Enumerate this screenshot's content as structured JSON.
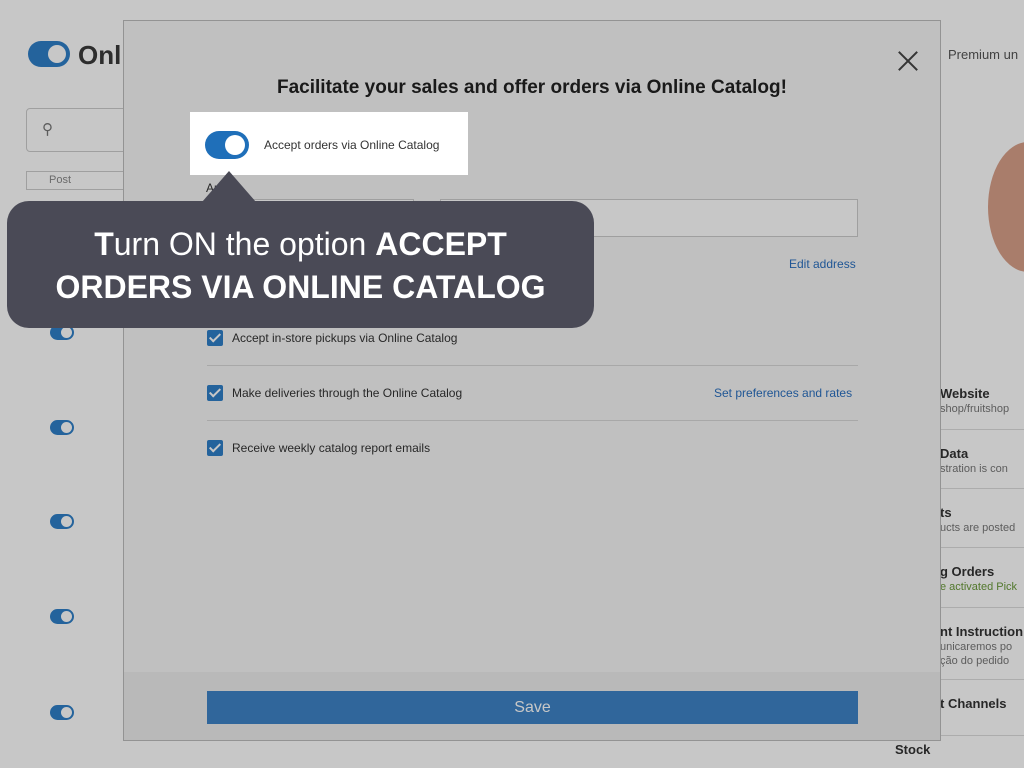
{
  "background": {
    "title": "Onli",
    "post_tab": "Post",
    "premium": "Premium un",
    "side_items": [
      {
        "title": "Website",
        "sub": "shop/fruitshop"
      },
      {
        "title": "Data",
        "sub": "stration is con"
      },
      {
        "title": "ts",
        "sub": "ucts are posted"
      },
      {
        "title": "g Orders",
        "sub": "e activated Pick"
      },
      {
        "title": "nt Instruction",
        "sub": "unicaremos po"
      },
      {
        "title": "t Channels",
        "sub": ""
      }
    ],
    "side_extra_sub": "ção do pedido",
    "stock": "Stock"
  },
  "modal": {
    "title": "Facilitate your sales and offer orders via Online Catalog!",
    "toggle_label": "Accept orders via Online Catalog",
    "toggle_on": true,
    "field_label": "App *",
    "edit_address": "Edit address",
    "options": [
      {
        "label": "Accept in-store pickups via Online Catalog",
        "checked": true,
        "link": ""
      },
      {
        "label": "Make deliveries through the Online Catalog",
        "checked": true,
        "link": "Set preferences and rates"
      },
      {
        "label": "Receive weekly catalog report emails",
        "checked": true,
        "link": ""
      }
    ],
    "save": "Save"
  },
  "callout": {
    "prefix_bold": "T",
    "middle": "urn ON the option ",
    "bold_line1": "ACCEPT",
    "line2": "ORDERS VIA ONLINE CATALOG"
  },
  "colors": {
    "accent": "#1f6fb9",
    "callout_bg": "#4a4a56",
    "link": "#2a6fbf"
  }
}
